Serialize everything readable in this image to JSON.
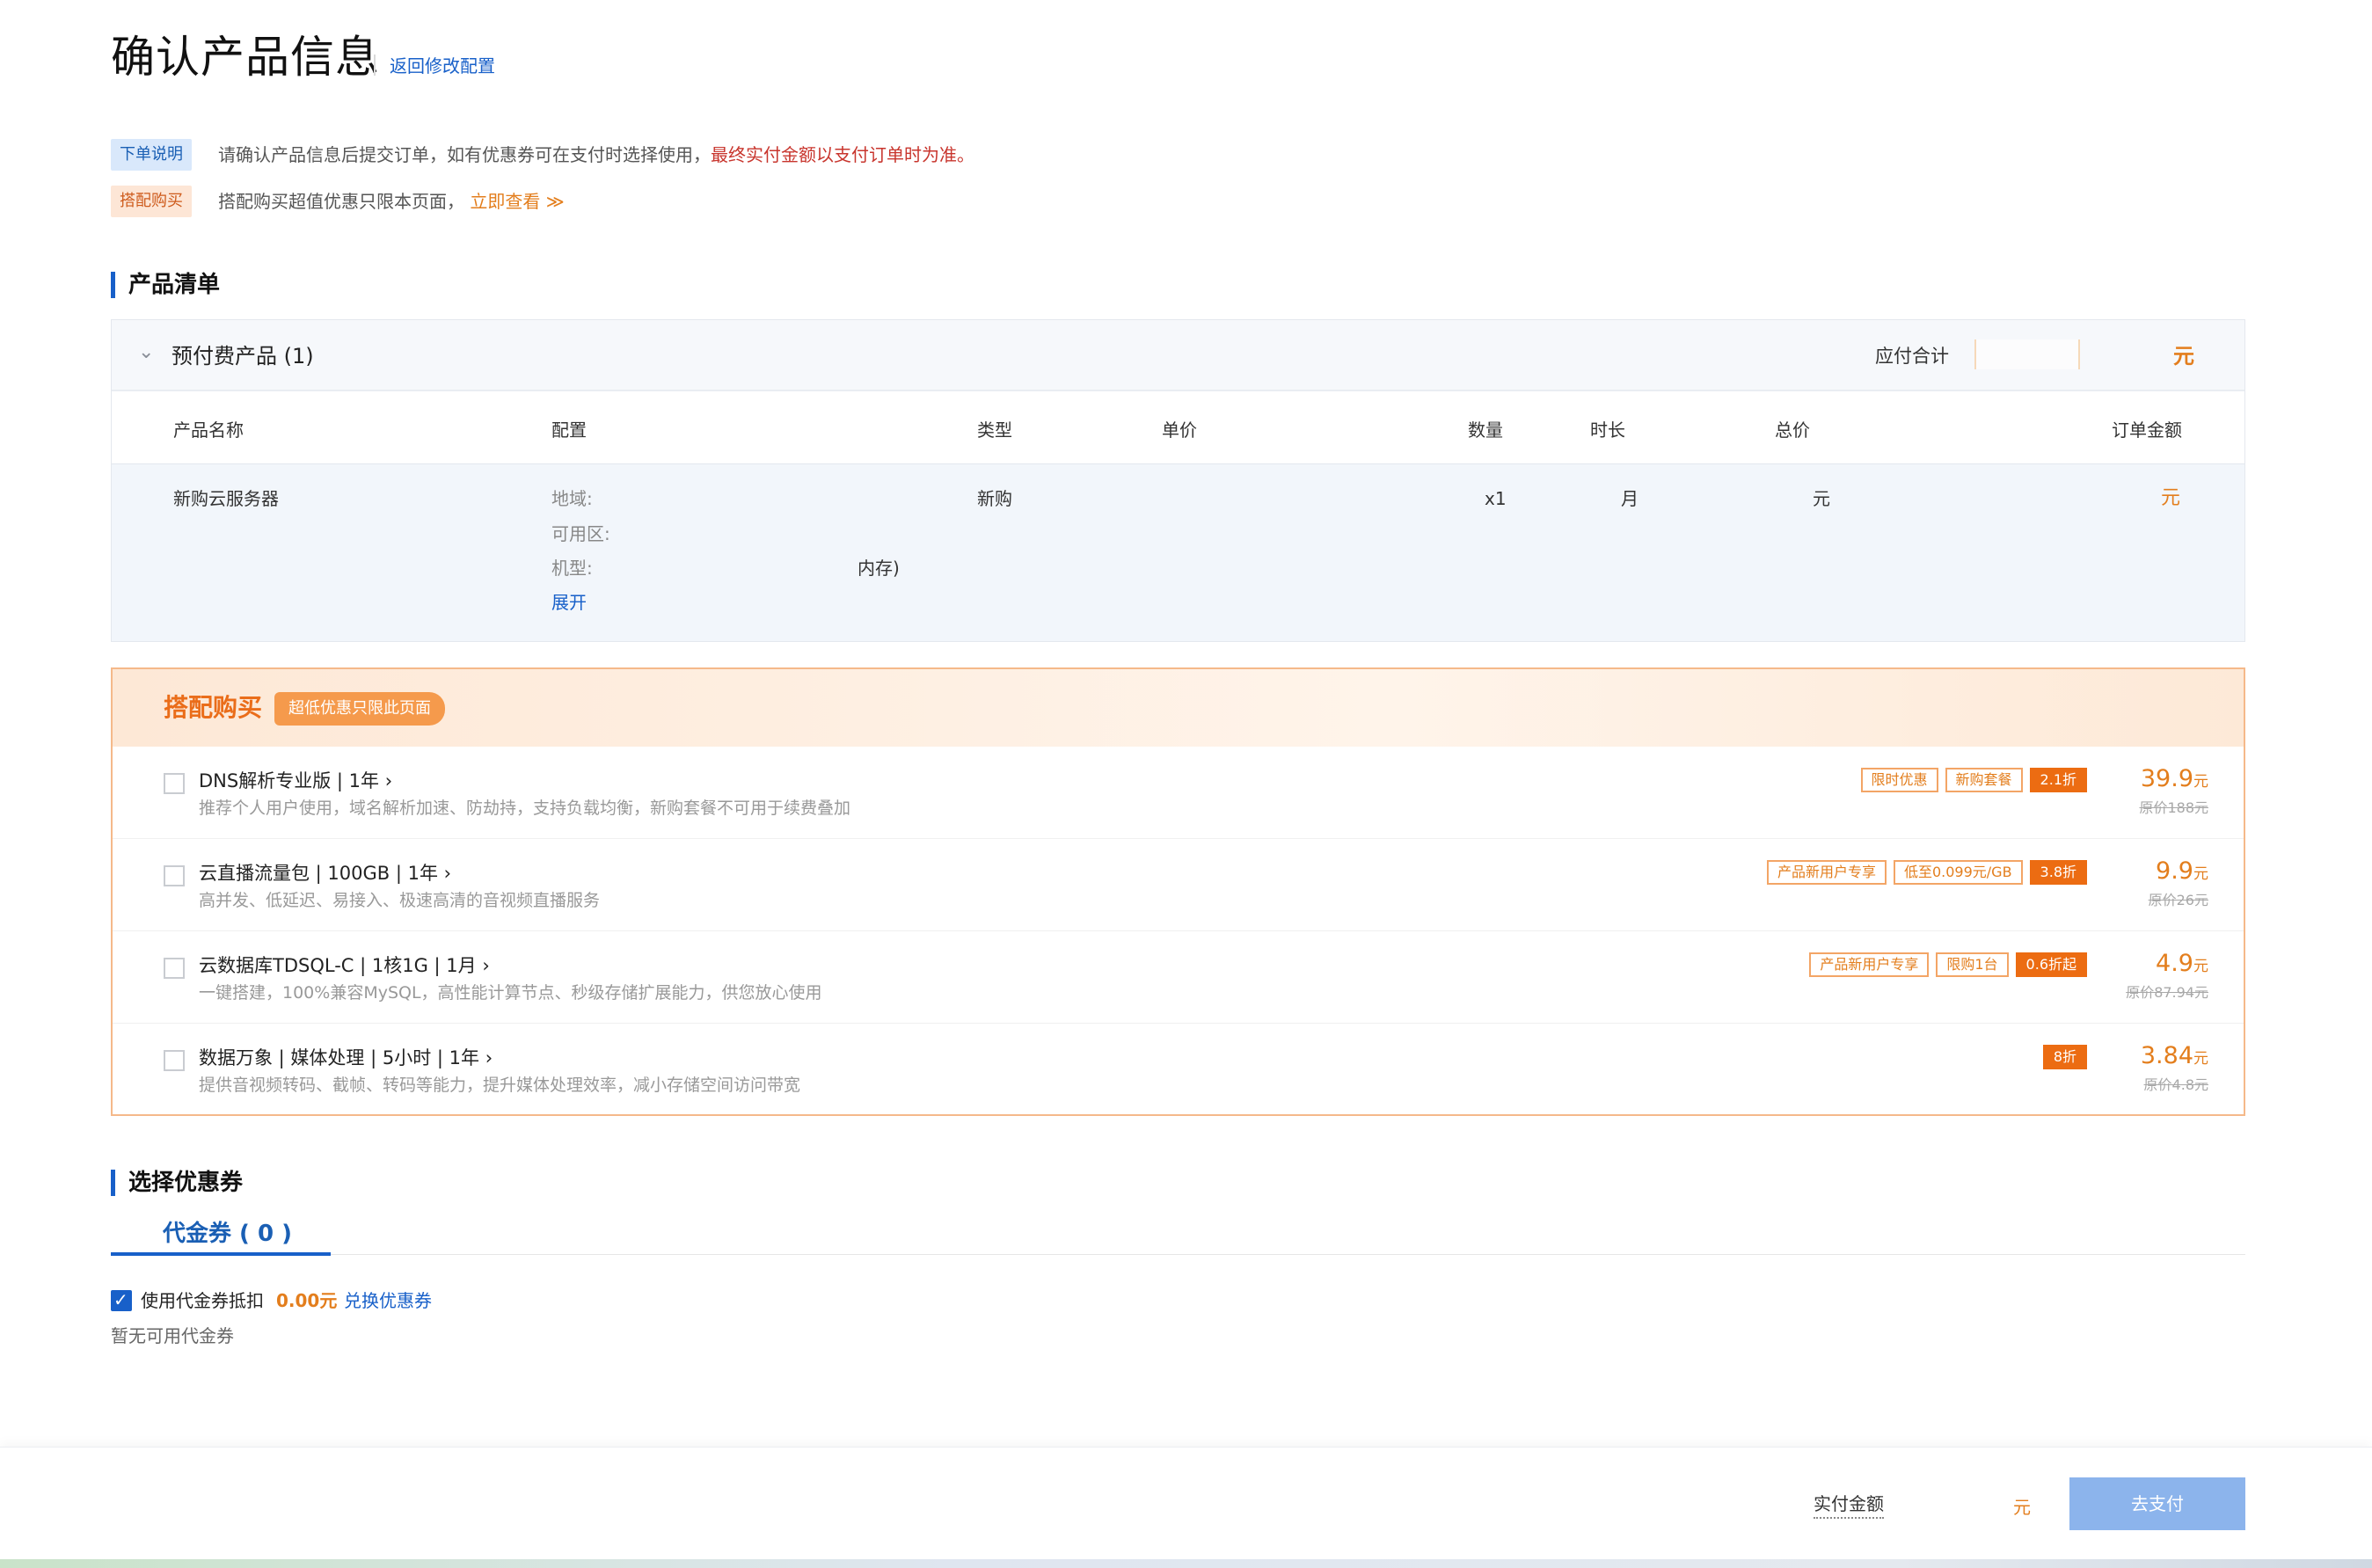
{
  "header": {
    "title": "确认产品信息",
    "back_link": "返回修改配置"
  },
  "notices": {
    "order_tag": "下单说明",
    "order_text": "请确认产品信息后提交订单，如有优惠券可在支付时选择使用，",
    "order_red": "最终实付金额以支付订单时为准。",
    "bundle_tag": "搭配购买",
    "bundle_text": "搭配购买超值优惠只限本页面，",
    "bundle_link": "立即查看 ≫"
  },
  "product_list": {
    "section_title": "产品清单",
    "group_title": "预付费产品 (1)",
    "total_label": "应付合计",
    "total_unit": "元",
    "columns": [
      "产品名称",
      "配置",
      "类型",
      "单价",
      "数量",
      "时长",
      "总价",
      "订单金额"
    ],
    "row": {
      "name": "新购云服务器",
      "region_label": "地域:",
      "zone_label": "可用区:",
      "model_label": "机型:",
      "model_value_fragment": "内存)",
      "expand_link": "展开",
      "type": "新购",
      "quantity": "x1",
      "duration": "月",
      "total_fragment": "元",
      "order_amount_unit": "元"
    }
  },
  "bundle": {
    "title": "搭配购买",
    "badge": "超低优惠只限此页面",
    "items": [
      {
        "name": "DNS解析专业版 | 1年",
        "desc": "推荐个人用户使用，域名解析加速、防劫持，支持负载均衡，新购套餐不可用于续费叠加",
        "tags": [
          "限时优惠",
          "新购套餐"
        ],
        "discount": "2.1折",
        "price": "39.9",
        "unit": "元",
        "original": "原价188元"
      },
      {
        "name": "云直播流量包 | 100GB | 1年",
        "desc": "高并发、低延迟、易接入、极速高清的音视频直播服务",
        "tags": [
          "产品新用户专享",
          "低至0.099元/GB"
        ],
        "discount": "3.8折",
        "price": "9.9",
        "unit": "元",
        "original": "原价26元"
      },
      {
        "name": "云数据库TDSQL-C | 1核1G | 1月",
        "desc": "一键搭建，100%兼容MySQL，高性能计算节点、秒级存储扩展能力，供您放心使用",
        "tags": [
          "产品新用户专享",
          "限购1台"
        ],
        "discount": "0.6折起",
        "price": "4.9",
        "unit": "元",
        "original": "原价87.94元"
      },
      {
        "name": "数据万象 | 媒体处理 | 5小时 | 1年",
        "desc": "提供音视频转码、截帧、转码等能力，提升媒体处理效率，减小存储空间访问带宽",
        "tags": [],
        "discount": "8折",
        "price": "3.84",
        "unit": "元",
        "original": "原价4.8元"
      }
    ]
  },
  "coupon": {
    "section_title": "选择优惠券",
    "tab": "代金券 ( 0 )",
    "use_label": "使用代金券抵扣",
    "amount": "0.00元",
    "exchange": "兑换优惠券",
    "empty": "暂无可用代金券"
  },
  "footer": {
    "pay_label": "实付金额",
    "pay_unit": "元",
    "pay_button": "去支付"
  },
  "colors": {
    "primary": "#1860c9",
    "accent": "#e37e1d",
    "warning_red": "#c8352d",
    "pay_button": "#8cb4ec"
  }
}
